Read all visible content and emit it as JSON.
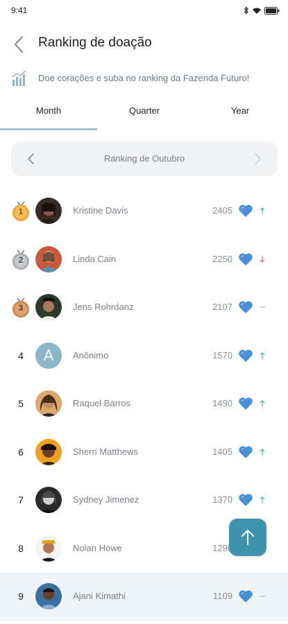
{
  "status_bar": {
    "time": "9:41"
  },
  "header": {
    "title": "Ranking de doação"
  },
  "info": {
    "text": "Doe corações e suba no ranking da Fazenda Futuro!"
  },
  "tabs": [
    {
      "label": "Month",
      "active": true
    },
    {
      "label": "Quarter",
      "active": false
    },
    {
      "label": "Year",
      "active": false
    }
  ],
  "month_nav": {
    "label": "Ranking de Outubro"
  },
  "ranking": [
    {
      "rank": "1",
      "name": "Kristine Davis",
      "points": "2405",
      "trend": "up",
      "medal": "gold"
    },
    {
      "rank": "2",
      "name": "Linda Cain",
      "points": "2250",
      "trend": "down",
      "medal": "silver"
    },
    {
      "rank": "3",
      "name": "Jens Rohrdanz",
      "points": "2107",
      "trend": "same",
      "medal": "bronze"
    },
    {
      "rank": "4",
      "name": "Anônimo",
      "points": "1570",
      "trend": "up",
      "avatar_letter": "A"
    },
    {
      "rank": "5",
      "name": "Raquel Barros",
      "points": "1490",
      "trend": "up"
    },
    {
      "rank": "6",
      "name": "Sherri Matthews",
      "points": "1405",
      "trend": "up"
    },
    {
      "rank": "7",
      "name": "Sydney Jimenez",
      "points": "1370",
      "trend": "up"
    },
    {
      "rank": "8",
      "name": "Nolan Howe",
      "points": "1290",
      "trend": "up"
    },
    {
      "rank": "9",
      "name": "Ajani Kimathi",
      "points": "1109",
      "trend": "same",
      "highlight": true
    }
  ],
  "colors": {
    "accent": "#3e93ad",
    "tab_underline": "#9cc5cf",
    "heart": "#4a90d9",
    "trend_up": "#4fb3b0",
    "trend_down": "#e06b6b",
    "trend_same": "#b0b5ba",
    "gold": "#e8a63b",
    "silver": "#b9bcc0",
    "bronze": "#c98a55"
  },
  "icons": {
    "back": "chevron-left-icon",
    "info": "bar-chart-icon",
    "heart": "heart-icon",
    "fab": "arrow-up-icon"
  }
}
